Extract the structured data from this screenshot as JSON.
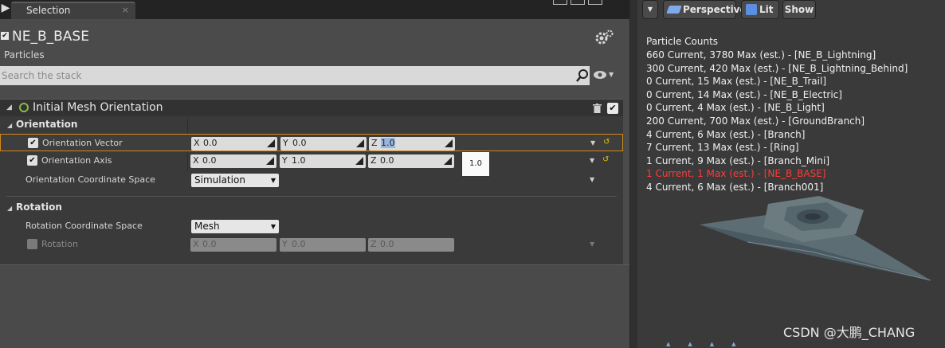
{
  "tab": {
    "label": "Selection",
    "close": "×",
    "arrow": "▶"
  },
  "emitter": {
    "name": "NE_B_BASE",
    "subtitle": "Particles",
    "enabled_mark": "✔"
  },
  "search": {
    "placeholder": "Search the stack"
  },
  "module": {
    "title": "Initial Mesh Orientation",
    "enabled_mark": "✔",
    "categories": [
      {
        "label": "Orientation",
        "properties": [
          {
            "label": "Orientation Vector",
            "checked": true,
            "x": "0.0",
            "y": "0.0",
            "z": "1.0",
            "selected": true
          },
          {
            "label": "Orientation Axis",
            "checked": true,
            "x": "0.0",
            "y": "1.0",
            "z": "0.0"
          },
          {
            "label": "Orientation Coordinate Space",
            "value": "Simulation"
          }
        ]
      },
      {
        "label": "Rotation",
        "properties": [
          {
            "label": "Rotation Coordinate Space",
            "value": "Mesh"
          },
          {
            "label": "Rotation",
            "checked": false,
            "disabled": true,
            "x": "0.0",
            "y": "0.0",
            "z": "0.0"
          }
        ]
      }
    ],
    "axis_labels": {
      "x": "X",
      "y": "Y",
      "z": "Z"
    },
    "tooltip": "1.0"
  },
  "viewport": {
    "buttons": {
      "menu": "▼",
      "perspective": "Perspective",
      "lit": "Lit",
      "show": "Show"
    },
    "particle_counts_title": "Particle Counts",
    "particle_counts": [
      {
        "text": "660 Current, 3780 Max (est.) - [NE_B_Lightning]",
        "highlight": false
      },
      {
        "text": "300 Current, 420 Max (est.) - [NE_B_Lightning_Behind]",
        "highlight": false
      },
      {
        "text": "0 Current, 15 Max (est.) - [NE_B_Trail]",
        "highlight": false
      },
      {
        "text": "0 Current, 14 Max (est.) - [NE_B_Electric]",
        "highlight": false
      },
      {
        "text": "0 Current, 4 Max (est.) - [NE_B_Light]",
        "highlight": false
      },
      {
        "text": "200 Current, 700 Max (est.) - [GroundBranch]",
        "highlight": false
      },
      {
        "text": "4 Current, 6 Max (est.) - [Branch]",
        "highlight": false
      },
      {
        "text": "7 Current, 13 Max (est.) - [Ring]",
        "highlight": false
      },
      {
        "text": "1 Current, 9 Max (est.) - [Branch_Mini]",
        "highlight": false
      },
      {
        "text": "1 Current, 1 Max (est.) - [NE_B_BASE]",
        "highlight": true
      },
      {
        "text": "4 Current, 6 Max (est.) - [Branch001]",
        "highlight": false
      }
    ],
    "watermark": "CSDN @大鹏_CHANG"
  },
  "colors": {
    "highlight": "#ff3a3a",
    "selection_border": "#d08a1a",
    "accent_green": "#8bb84a",
    "reset_yellow": "#d7c21a"
  }
}
